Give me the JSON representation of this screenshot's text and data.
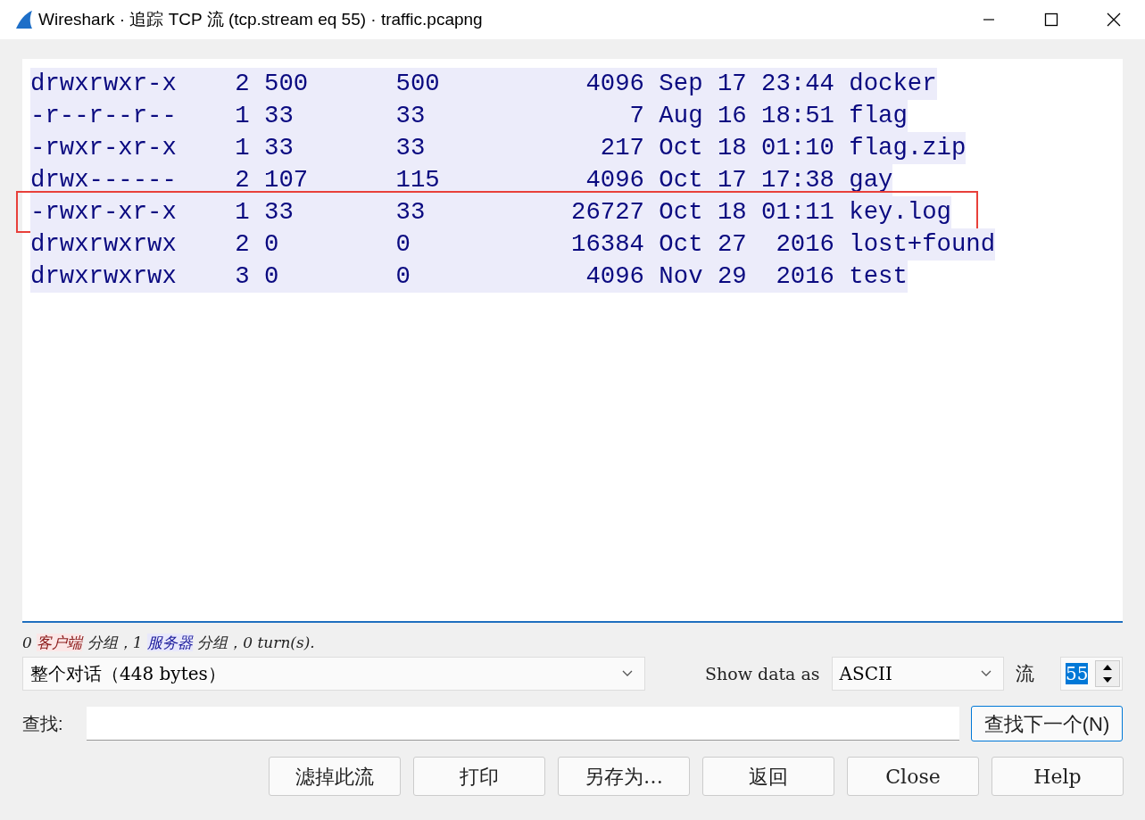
{
  "window": {
    "title": "Wireshark · 追踪 TCP 流 (tcp.stream eq 55) · traffic.pcapng"
  },
  "stream_lines": [
    {
      "text": "drwxrwxr-x    2 500      500          4096 Sep 17 23:44 docker",
      "highlighted": false
    },
    {
      "text": "-r--r--r--    1 33       33              7 Aug 16 18:51 flag",
      "highlighted": false
    },
    {
      "text": "-rwxr-xr-x    1 33       33            217 Oct 18 01:10 flag.zip",
      "highlighted": false
    },
    {
      "text": "drwx------    2 107      115          4096 Oct 17 17:38 gay",
      "highlighted": false
    },
    {
      "text": "-rwxr-xr-x    1 33       33          26727 Oct 18 01:11 key.log",
      "highlighted": true
    },
    {
      "text": "drwxrwxrwx    2 0        0           16384 Oct 27  2016 lost+found",
      "highlighted": false
    },
    {
      "text": "drwxrwxrwx    3 0        0            4096 Nov 29  2016 test",
      "highlighted": false
    }
  ],
  "status": [
    {
      "text": "0 ",
      "kind": "plain"
    },
    {
      "text": "客户端",
      "kind": "client"
    },
    {
      "text": " 分组，1 ",
      "kind": "plain"
    },
    {
      "text": "服务器",
      "kind": "server"
    },
    {
      "text": " 分组，0 turn(s).",
      "kind": "plain"
    }
  ],
  "conversation_select": {
    "value": "整个对话（448 bytes）"
  },
  "show_data_as": {
    "label": "Show data as",
    "value": "ASCII"
  },
  "stream": {
    "label": "流",
    "value": "55"
  },
  "find": {
    "label": "查找:",
    "button": "查找下一个(N)"
  },
  "buttons": [
    "滤掉此流",
    "打印",
    "另存为…",
    "返回",
    "Close",
    "Help"
  ]
}
